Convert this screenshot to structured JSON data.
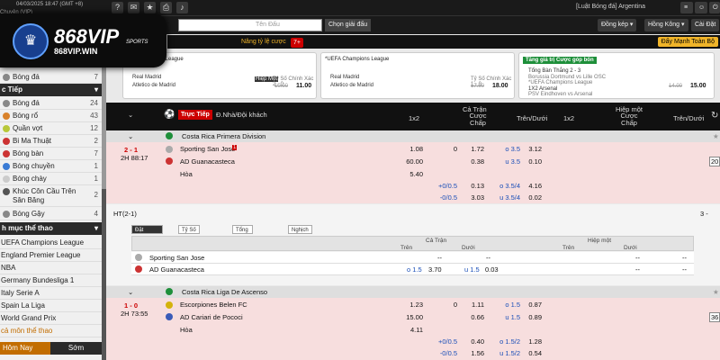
{
  "top": {
    "datetime": "04/03/2025 18:47 (GMT +8)",
    "left_cut": "Chuyên (VIP)",
    "links": "[Luật Bóng đá] Argentina",
    "icon_info": "?",
    "icon_mail": "✉",
    "icon_star": "★",
    "icon_print": "⎙",
    "icon_sound": "♪"
  },
  "bar2": {
    "search_placeholder": "Tên Đấu",
    "choose": "Chọn giải đấu",
    "odds_type": "Đồng kép",
    "odds_format": "Hồng Kông",
    "settings": "Cài Đặt"
  },
  "logo": {
    "brand": "868VIP",
    "sub": "868VIP.WIN",
    "tag": "SPORTS"
  },
  "promo": {
    "text": "Nâng tỷ lệ cược",
    "badge": "7+",
    "live_btn": "Đẩy Mạnh Toàn Bộ"
  },
  "cards": [
    {
      "title": "... League",
      "team1": "Real Madrid",
      "team2": "Atletico de Madrid",
      "label": "Hiệp Một",
      "score_label": "Tỷ Số Chính Xác 2 - 0",
      "old": "10.00",
      "odd": "11.00"
    },
    {
      "title": "*UEFA Champions League",
      "team1": "Real Madrid",
      "team2": "Atletico de Madrid",
      "score_label": "Tỷ Số Chính Xác 1 - 0",
      "old": "17.00",
      "odd": "18.00"
    },
    {
      "title": "Tăng giá trị Cược góp bổn",
      "line1": "Tổng Bàn Thắng 2 - 3",
      "line2": "Borussia Dortmund vs Lille OSC",
      "line3": "*UEFA Champions League",
      "line4": "1X2 Arsenal",
      "line5": "PSV Eindhoven vs Arsenal",
      "old": "14.00",
      "odd": "15.00"
    }
  ],
  "sidebar": {
    "top_rows": [
      {
        "label": "Bóng đá",
        "count": "7"
      }
    ],
    "live_head": "c Tiếp",
    "live_rows": [
      {
        "label": "Bóng đá",
        "count": "24"
      },
      {
        "label": "Bóng rổ",
        "count": "43"
      },
      {
        "label": "Quần vợt",
        "count": "12"
      },
      {
        "label": "Bi Ma Thuật",
        "count": "2"
      },
      {
        "label": "Bóng bàn",
        "count": "7"
      },
      {
        "label": "Bóng chuyền",
        "count": "1"
      },
      {
        "label": "Bóng chày",
        "count": "1"
      },
      {
        "label": "Khúc Côn Cầu Trên Sân Băng",
        "count": "2"
      },
      {
        "label": "Bóng Gậy",
        "count": "4"
      }
    ],
    "cat_head": "h mục thể thao",
    "cat_rows": [
      "UEFA Champions League",
      "England Premier League",
      "NBA",
      "Germany Bundesliga 1",
      "Italy Serie A",
      "Spain La Liga",
      "World Grand Prix"
    ],
    "more": "cả môn thể thao",
    "tab_today": "Hôm Nay",
    "tab_early": "Sớm"
  },
  "thead": {
    "live": "Trực Tiếp",
    "home_away": "Đ.Nhà/Đội khách",
    "full": "Cả Trận",
    "half": "Hiệp một",
    "x12": "1x2",
    "hdp": "Cược Chấp",
    "ou": "Trên/Dưới"
  },
  "leagues": [
    "Costa Rica Primera Division",
    "Costa Rica Liga De Ascenso"
  ],
  "m1": {
    "score": "2 - 1",
    "time": "2H 88:17",
    "team1": "Sporting San Jose",
    "red": "1",
    "team2": "AD Guanacasteca",
    "draw": "Hòa",
    "r1": {
      "x": "1.08",
      "h": "0",
      "ho": "1.72",
      "o": "o 3.5",
      "oo": "3.12"
    },
    "r2": {
      "x": "60.00",
      "ho": "0.38",
      "o": "u 3.5",
      "oo": "0.10"
    },
    "r3": {
      "x": "5.40"
    },
    "r4": {
      "h": "+0/0.5",
      "ho": "0.13",
      "o": "o 3.5/4",
      "oo": "4.16"
    },
    "r5": {
      "h": "-0/0.5",
      "ho": "3.03",
      "o": "u 3.5/4",
      "oo": "0.02"
    }
  },
  "detail": {
    "ht": "HT(2-1)",
    "more": "3 -",
    "tabs": [
      "Đặt Trên/Dưới",
      "Tỷ Số Chính Xác",
      "Tổng bàn thắng",
      "Nghịch Tỷ Số Chính Xác"
    ],
    "full": "Cả Trận",
    "half": "Hiệp một",
    "over": "Trên",
    "under": "Dưới",
    "team1": "Sporting San Jose",
    "team2": "AD Guanacasteca",
    "dash": "--",
    "o": "o 1.5",
    "ov": "3.70",
    "u": "u 1.5",
    "uv": "0.03"
  },
  "m2": {
    "score": "1 - 0",
    "time": "2H 73:55",
    "team1": "Escorpiones Belen FC",
    "team2": "AD Cariari de Pococi",
    "draw": "Hòa",
    "r1": {
      "x": "1.23",
      "h": "0",
      "ho": "1.11",
      "o": "o 1.5",
      "oo": "0.87"
    },
    "r2": {
      "x": "15.00",
      "ho": "0.66",
      "o": "u 1.5",
      "oo": "0.89"
    },
    "r3": {
      "x": "4.11"
    },
    "r4": {
      "h": "+0/0.5",
      "ho": "0.40",
      "o": "o 1.5/2",
      "oo": "1.28"
    },
    "r5": {
      "h": "-0/0.5",
      "ho": "1.56",
      "o": "u 1.5/2",
      "oo": "0.54"
    }
  },
  "right_cut": {
    "a": "20",
    "b": "36"
  }
}
